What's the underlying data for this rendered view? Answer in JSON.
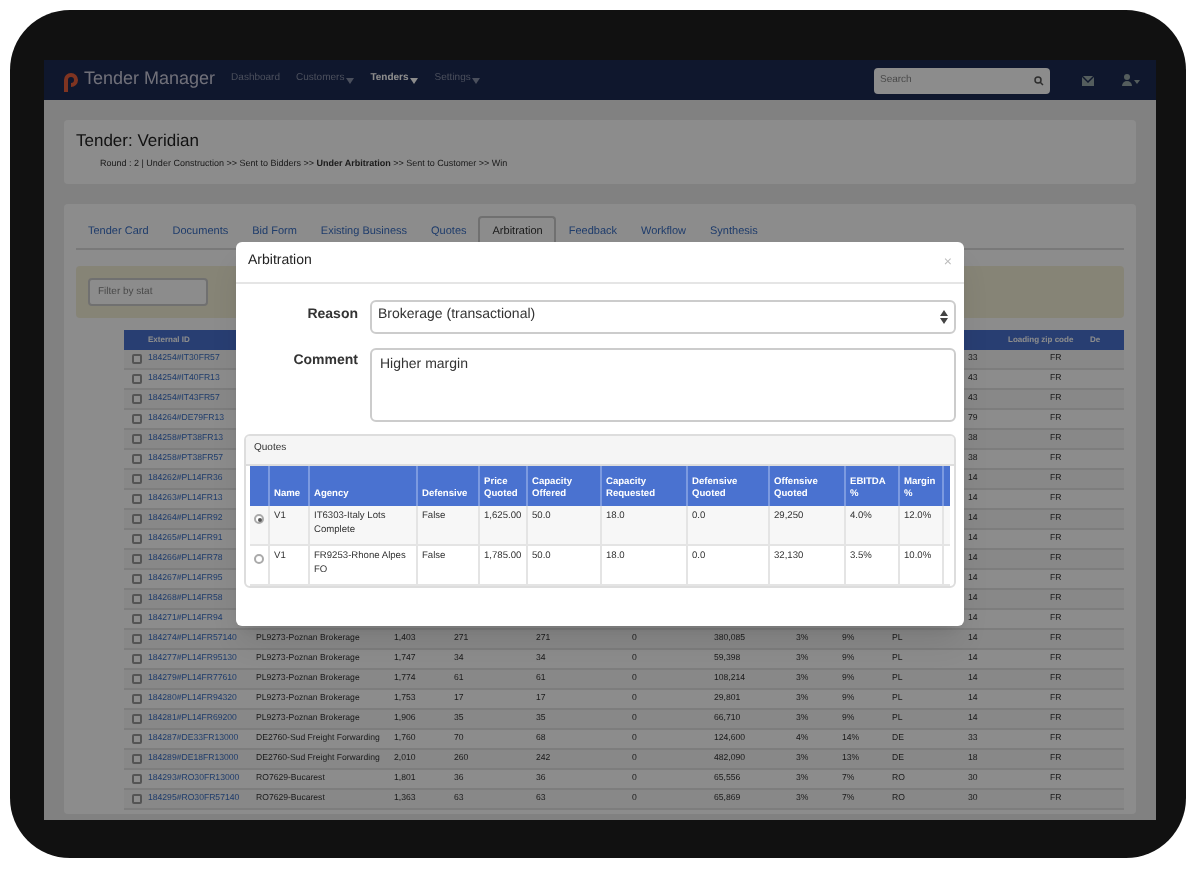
{
  "navbar": {
    "brand": "Tender Manager",
    "items": [
      {
        "label": "Dashboard",
        "dropdown": false,
        "selected": false
      },
      {
        "label": "Customers",
        "dropdown": true,
        "selected": false
      },
      {
        "label": "Tenders",
        "dropdown": true,
        "selected": true
      },
      {
        "label": "Settings",
        "dropdown": true,
        "selected": false
      }
    ],
    "search": {
      "placeholder": "Search"
    }
  },
  "header": {
    "title": "Tender: Veridian",
    "breadcrumb": "Round : 2 | Under Construction >> Sent to Bidders >> **Under Arbitration** >> Sent to Customer >> Win"
  },
  "tabs": [
    {
      "label": "Tender Card",
      "selected": false
    },
    {
      "label": "Documents",
      "selected": false
    },
    {
      "label": "Bid Form",
      "selected": false
    },
    {
      "label": "Existing Business",
      "selected": false
    },
    {
      "label": "Quotes",
      "selected": false
    },
    {
      "label": "Arbitration",
      "selected": true
    },
    {
      "label": "Feedback",
      "selected": false
    },
    {
      "label": "Workflow",
      "selected": false
    },
    {
      "label": "Synthesis",
      "selected": false
    }
  ],
  "filter": {
    "placeholder": "Filter by stat"
  },
  "table": {
    "columns": [
      "External ID",
      "Loading zip code",
      "De"
    ],
    "rows": [
      {
        "checked": false,
        "external_id": "184254#IT30FR57",
        "zip": "33",
        "column_12": "FR"
      },
      {
        "checked": false,
        "external_id": "184254#IT40FR13",
        "zip": "43",
        "column_12": "FR"
      },
      {
        "checked": false,
        "external_id": "184254#IT43FR57",
        "zip": "43",
        "column_12": "FR"
      },
      {
        "checked": false,
        "external_id": "184264#DE79FR13",
        "zip": "79",
        "column_12": "FR"
      },
      {
        "checked": false,
        "external_id": "184258#PT38FR13",
        "zip": "38",
        "column_12": "FR"
      },
      {
        "checked": false,
        "external_id": "184258#PT38FR57",
        "zip": "38",
        "column_12": "FR"
      },
      {
        "checked": false,
        "external_id": "184262#PL14FR36",
        "zip": "14",
        "column_12": "FR"
      },
      {
        "checked": false,
        "external_id": "184263#PL14FR13",
        "zip": "14",
        "column_12": "FR"
      },
      {
        "checked": false,
        "external_id": "184264#PL14FR92",
        "zip": "14",
        "column_12": "FR"
      },
      {
        "checked": false,
        "external_id": "184265#PL14FR91",
        "zip": "14",
        "column_12": "FR"
      },
      {
        "checked": false,
        "external_id": "184266#PL14FR78",
        "zip": "14",
        "column_12": "FR"
      },
      {
        "checked": false,
        "external_id": "184267#PL14FR95",
        "zip": "14",
        "column_12": "FR"
      },
      {
        "checked": false,
        "external_id": "184268#PL14FR58",
        "zip": "14",
        "column_12": "FR"
      },
      {
        "checked": false,
        "external_id": "184271#PL14FR94",
        "zip": "14",
        "column_12": "FR"
      },
      {
        "checked": false,
        "external_id": "184274#PL14FR57140",
        "agency": "PL9273-Poznan Brokerage",
        "price": "1,403",
        "column_4": "271",
        "column_5": "271",
        "column_6": "0",
        "offensive": "380,085",
        "column_8": "3%",
        "column_9": "9%",
        "country": "PL",
        "zip": "14",
        "column_12": "FR"
      },
      {
        "checked": false,
        "external_id": "184277#PL14FR95130",
        "agency": "PL9273-Poznan Brokerage",
        "price": "1,747",
        "column_4": "34",
        "column_5": "34",
        "column_6": "0",
        "offensive": "59,398",
        "column_8": "3%",
        "column_9": "9%",
        "country": "PL",
        "zip": "14",
        "column_12": "FR"
      },
      {
        "checked": false,
        "external_id": "184279#PL14FR77610",
        "agency": "PL9273-Poznan Brokerage",
        "price": "1,774",
        "column_4": "61",
        "column_5": "61",
        "column_6": "0",
        "offensive": "108,214",
        "column_8": "3%",
        "column_9": "9%",
        "country": "PL",
        "zip": "14",
        "column_12": "FR"
      },
      {
        "checked": false,
        "external_id": "184280#PL14FR94320",
        "agency": "PL9273-Poznan Brokerage",
        "price": "1,753",
        "column_4": "17",
        "column_5": "17",
        "column_6": "0",
        "offensive": "29,801",
        "column_8": "3%",
        "column_9": "9%",
        "country": "PL",
        "zip": "14",
        "column_12": "FR"
      },
      {
        "checked": false,
        "external_id": "184281#PL14FR69200",
        "agency": "PL9273-Poznan Brokerage",
        "price": "1,906",
        "column_4": "35",
        "column_5": "35",
        "column_6": "0",
        "offensive": "66,710",
        "column_8": "3%",
        "column_9": "9%",
        "country": "PL",
        "zip": "14",
        "column_12": "FR"
      },
      {
        "checked": false,
        "external_id": "184287#DE33FR13000",
        "agency": "DE2760-Sud Freight Forwarding",
        "price": "1,760",
        "column_4": "70",
        "column_5": "68",
        "column_6": "0",
        "offensive": "124,600",
        "column_8": "4%",
        "column_9": "14%",
        "country": "DE",
        "zip": "33",
        "column_12": "FR"
      },
      {
        "checked": false,
        "external_id": "184289#DE18FR13000",
        "agency": "DE2760-Sud Freight Forwarding",
        "price": "2,010",
        "column_4": "260",
        "column_5": "242",
        "column_6": "0",
        "offensive": "482,090",
        "column_8": "3%",
        "column_9": "13%",
        "country": "DE",
        "zip": "18",
        "column_12": "FR"
      },
      {
        "checked": false,
        "external_id": "184293#RO30FR13000",
        "agency": "RO7629-Bucarest",
        "price": "1,801",
        "column_4": "36",
        "column_5": "36",
        "column_6": "0",
        "offensive": "65,556",
        "column_8": "3%",
        "column_9": "7%",
        "country": "RO",
        "zip": "30",
        "column_12": "FR"
      },
      {
        "checked": false,
        "external_id": "184295#RO30FR57140",
        "agency": "RO7629-Bucarest",
        "price": "1,363",
        "column_4": "63",
        "column_5": "63",
        "column_6": "0",
        "offensive": "65,869",
        "column_8": "3%",
        "column_9": "7%",
        "country": "RO",
        "zip": "30",
        "column_12": "FR"
      }
    ]
  },
  "modal": {
    "title": "Arbitration",
    "close": "×",
    "reason": {
      "label": "Reason",
      "value": "Brokerage (transactional)"
    },
    "comment": {
      "label": "Comment",
      "value": "Higher margin"
    },
    "quotes": {
      "title": "Quotes",
      "columns": [
        "Name",
        "Agency",
        "Defensive",
        "Price Quoted",
        "Capacity Offered",
        "Capacity Requested",
        "Defensive Quoted",
        "Offensive Quoted",
        "EBITDA %",
        "Margin %"
      ],
      "rows": [
        {
          "selected": true,
          "cells": [
            "V1",
            "IT6303-Italy Lots Complete",
            "False",
            "1,625.00",
            "50.0",
            "18.0",
            "0.0",
            "29,250",
            "4.0%",
            "12.0%"
          ]
        },
        {
          "selected": false,
          "cells": [
            "V1",
            "FR9253-Rhone Alpes FO",
            "False",
            "1,785.00",
            "50.0",
            "18.0",
            "0.0",
            "32,130",
            "3.5%",
            "10.0%"
          ]
        }
      ]
    }
  }
}
